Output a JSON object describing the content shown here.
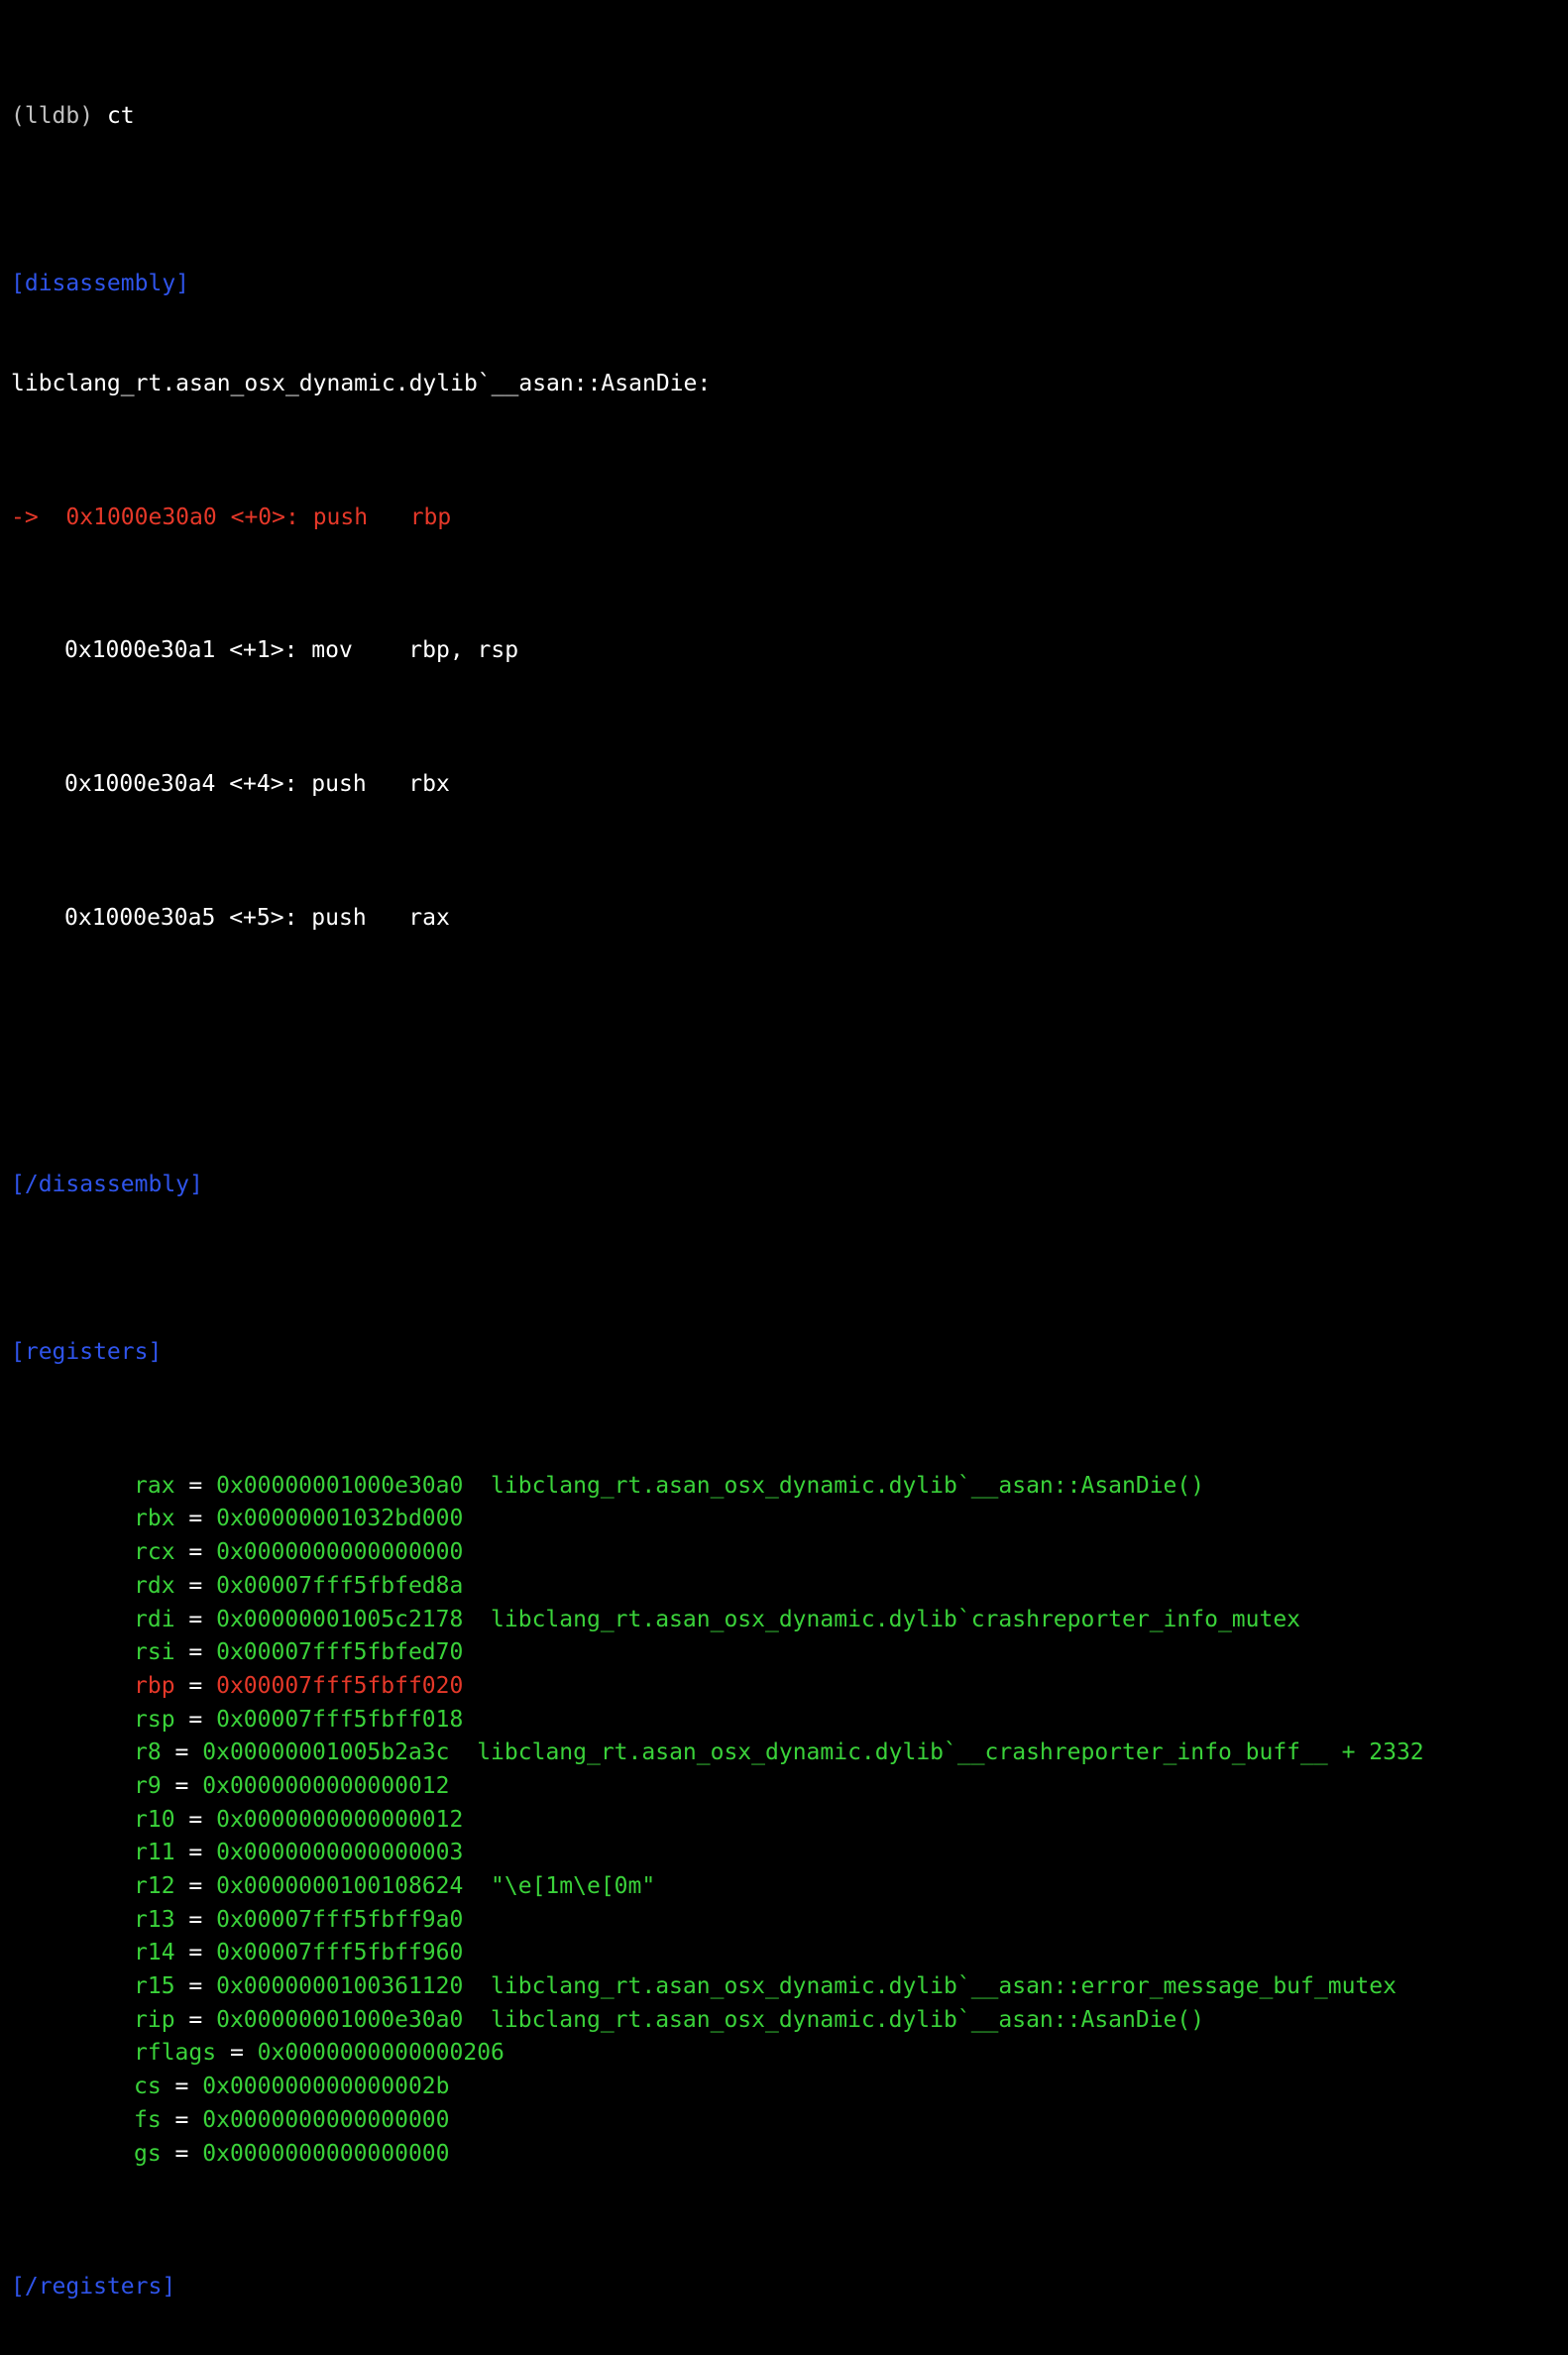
{
  "colors": {
    "background": "#000000",
    "prompt": "#c0c0c0",
    "section_tag": "#2f54ea",
    "current_pc": "#e53829",
    "register": "#3ad23a",
    "text": "#ffffff"
  },
  "prompt": "(lldb)",
  "command": "ct",
  "disassembly": {
    "open_tag": "[disassembly]",
    "close_tag": "[/disassembly]",
    "function_header": "libclang_rt.asan_osx_dynamic.dylib`__asan::AsanDie:",
    "arrow": "->",
    "instructions": [
      {
        "address": "0x1000e30a0",
        "offset": "<+0>:",
        "mnemonic": "push",
        "operands": "rbp",
        "current": true
      },
      {
        "address": "0x1000e30a1",
        "offset": "<+1>:",
        "mnemonic": "mov",
        "operands": "rbp, rsp",
        "current": false
      },
      {
        "address": "0x1000e30a4",
        "offset": "<+4>:",
        "mnemonic": "push",
        "operands": "rbx",
        "current": false
      },
      {
        "address": "0x1000e30a5",
        "offset": "<+5>:",
        "mnemonic": "push",
        "operands": "rax",
        "current": false
      }
    ]
  },
  "registers": {
    "open_tag": "[registers]",
    "close_tag": "[/registers]",
    "items": [
      {
        "name": "rax",
        "value": "0x00000001000e30a0",
        "symbol": "libclang_rt.asan_osx_dynamic.dylib`__asan::AsanDie()",
        "changed": false
      },
      {
        "name": "rbx",
        "value": "0x00000001032bd000",
        "symbol": "",
        "changed": false
      },
      {
        "name": "rcx",
        "value": "0x0000000000000000",
        "symbol": "",
        "changed": false
      },
      {
        "name": "rdx",
        "value": "0x00007fff5fbfed8a",
        "symbol": "",
        "changed": false
      },
      {
        "name": "rdi",
        "value": "0x00000001005c2178",
        "symbol": "libclang_rt.asan_osx_dynamic.dylib`crashreporter_info_mutex",
        "changed": false
      },
      {
        "name": "rsi",
        "value": "0x00007fff5fbfed70",
        "symbol": "",
        "changed": false
      },
      {
        "name": "rbp",
        "value": "0x00007fff5fbff020",
        "symbol": "",
        "changed": true
      },
      {
        "name": "rsp",
        "value": "0x00007fff5fbff018",
        "symbol": "",
        "changed": false
      },
      {
        "name": "r8",
        "value": "0x00000001005b2a3c",
        "symbol": "libclang_rt.asan_osx_dynamic.dylib`__crashreporter_info_buff__ + 2332",
        "changed": false
      },
      {
        "name": "r9",
        "value": "0x0000000000000012",
        "symbol": "",
        "changed": false
      },
      {
        "name": "r10",
        "value": "0x0000000000000012",
        "symbol": "",
        "changed": false
      },
      {
        "name": "r11",
        "value": "0x0000000000000003",
        "symbol": "",
        "changed": false
      },
      {
        "name": "r12",
        "value": "0x0000000100108624",
        "symbol": "\"\\e[1m\\e[0m\"",
        "changed": false
      },
      {
        "name": "r13",
        "value": "0x00007fff5fbff9a0",
        "symbol": "",
        "changed": false
      },
      {
        "name": "r14",
        "value": "0x00007fff5fbff960",
        "symbol": "",
        "changed": false
      },
      {
        "name": "r15",
        "value": "0x0000000100361120",
        "symbol": "libclang_rt.asan_osx_dynamic.dylib`__asan::error_message_buf_mutex",
        "changed": false
      },
      {
        "name": "rip",
        "value": "0x00000001000e30a0",
        "symbol": "libclang_rt.asan_osx_dynamic.dylib`__asan::AsanDie()",
        "changed": false
      },
      {
        "name": "rflags",
        "value": "0x0000000000000206",
        "symbol": "",
        "changed": false
      },
      {
        "name": "cs",
        "value": "0x000000000000002b",
        "symbol": "",
        "changed": false
      },
      {
        "name": "fs",
        "value": "0x0000000000000000",
        "symbol": "",
        "changed": false
      },
      {
        "name": "gs",
        "value": "0x0000000000000000",
        "symbol": "",
        "changed": false
      }
    ]
  }
}
